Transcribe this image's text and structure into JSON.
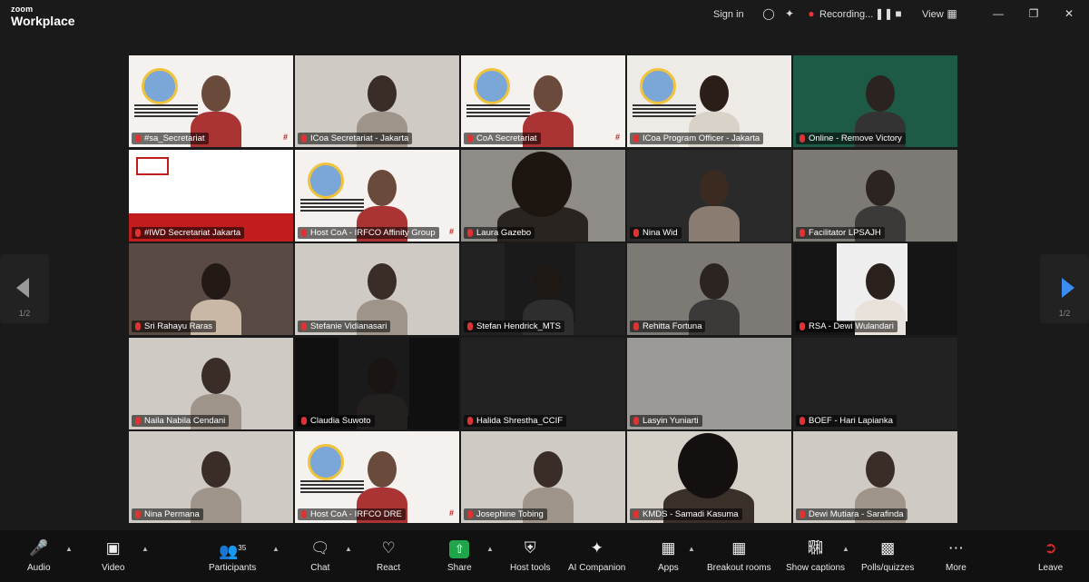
{
  "app": {
    "logo_top": "zoom",
    "logo_bottom": "Workplace"
  },
  "titlebar": {
    "sign_in": "Sign in",
    "recording": "Recording...",
    "view": "View"
  },
  "participants": [
    {
      "name": "#sa_Secretariat",
      "style": "banner"
    },
    {
      "name": "ICoa Secretariat - Jakarta",
      "style": "grey"
    },
    {
      "name": "CoA Secretariat",
      "style": "banner"
    },
    {
      "name": "ICoa Program Officer - Jakarta",
      "style": "banner2"
    },
    {
      "name": "Online - Remove Victory",
      "style": "green"
    },
    {
      "name": "#IWD Secretariat Jakarta",
      "style": "banner3"
    },
    {
      "name": "Host CoA - IRFCO Affinity Group",
      "style": "banner"
    },
    {
      "name": "Laura Gazebo",
      "style": "closeup"
    },
    {
      "name": "Nina Wid",
      "style": "dark"
    },
    {
      "name": "Facilitator LPSAJH",
      "style": "grey2"
    },
    {
      "name": "Sri Rahayu Raras",
      "style": "warm"
    },
    {
      "name": "Stefanie Vidianasari",
      "style": "grey"
    },
    {
      "name": "Stefan Hendrick_MTS",
      "style": "dark2"
    },
    {
      "name": "Rehitta Fortuna",
      "style": "grey2"
    },
    {
      "name": "RSA - Dewi Wulandari",
      "style": "blackwhite"
    },
    {
      "name": "Naila Nabila Cendani",
      "style": "grey"
    },
    {
      "name": "Claudia Suwoto",
      "style": "black"
    },
    {
      "name": "Halida Shrestha_CCIF",
      "style": "empty"
    },
    {
      "name": "Lasyin Yuniarti",
      "style": "greyempty"
    },
    {
      "name": "BOEF - Hari Lapianka",
      "style": "empty2"
    },
    {
      "name": "Nina Permana",
      "style": "grey"
    },
    {
      "name": "Host CoA - IRFCO DRE",
      "style": "banner"
    },
    {
      "name": "Josephine Tobing",
      "style": "grey"
    },
    {
      "name": "KMDS - Samadi Kasuma",
      "style": "closeup2"
    },
    {
      "name": "Dewi Mutiara - Sarafinda",
      "style": "grey"
    }
  ],
  "nav": {
    "left_page": "1/2",
    "right_page": "1/2"
  },
  "toolbar": {
    "audio": "Audio",
    "video": "Video",
    "participants": "Participants",
    "participants_count": "35",
    "chat": "Chat",
    "react": "React",
    "share": "Share",
    "host_tools": "Host tools",
    "ai_companion": "AI Companion",
    "apps": "Apps",
    "breakout_rooms": "Breakout rooms",
    "show_captions": "Show captions",
    "polls": "Polls/quizzes",
    "more": "More",
    "leave": "Leave"
  },
  "colors": {
    "share_green": "#1fa64a",
    "leave_red": "#e02828",
    "nav_arrow_blue": "#3b8bf0"
  }
}
